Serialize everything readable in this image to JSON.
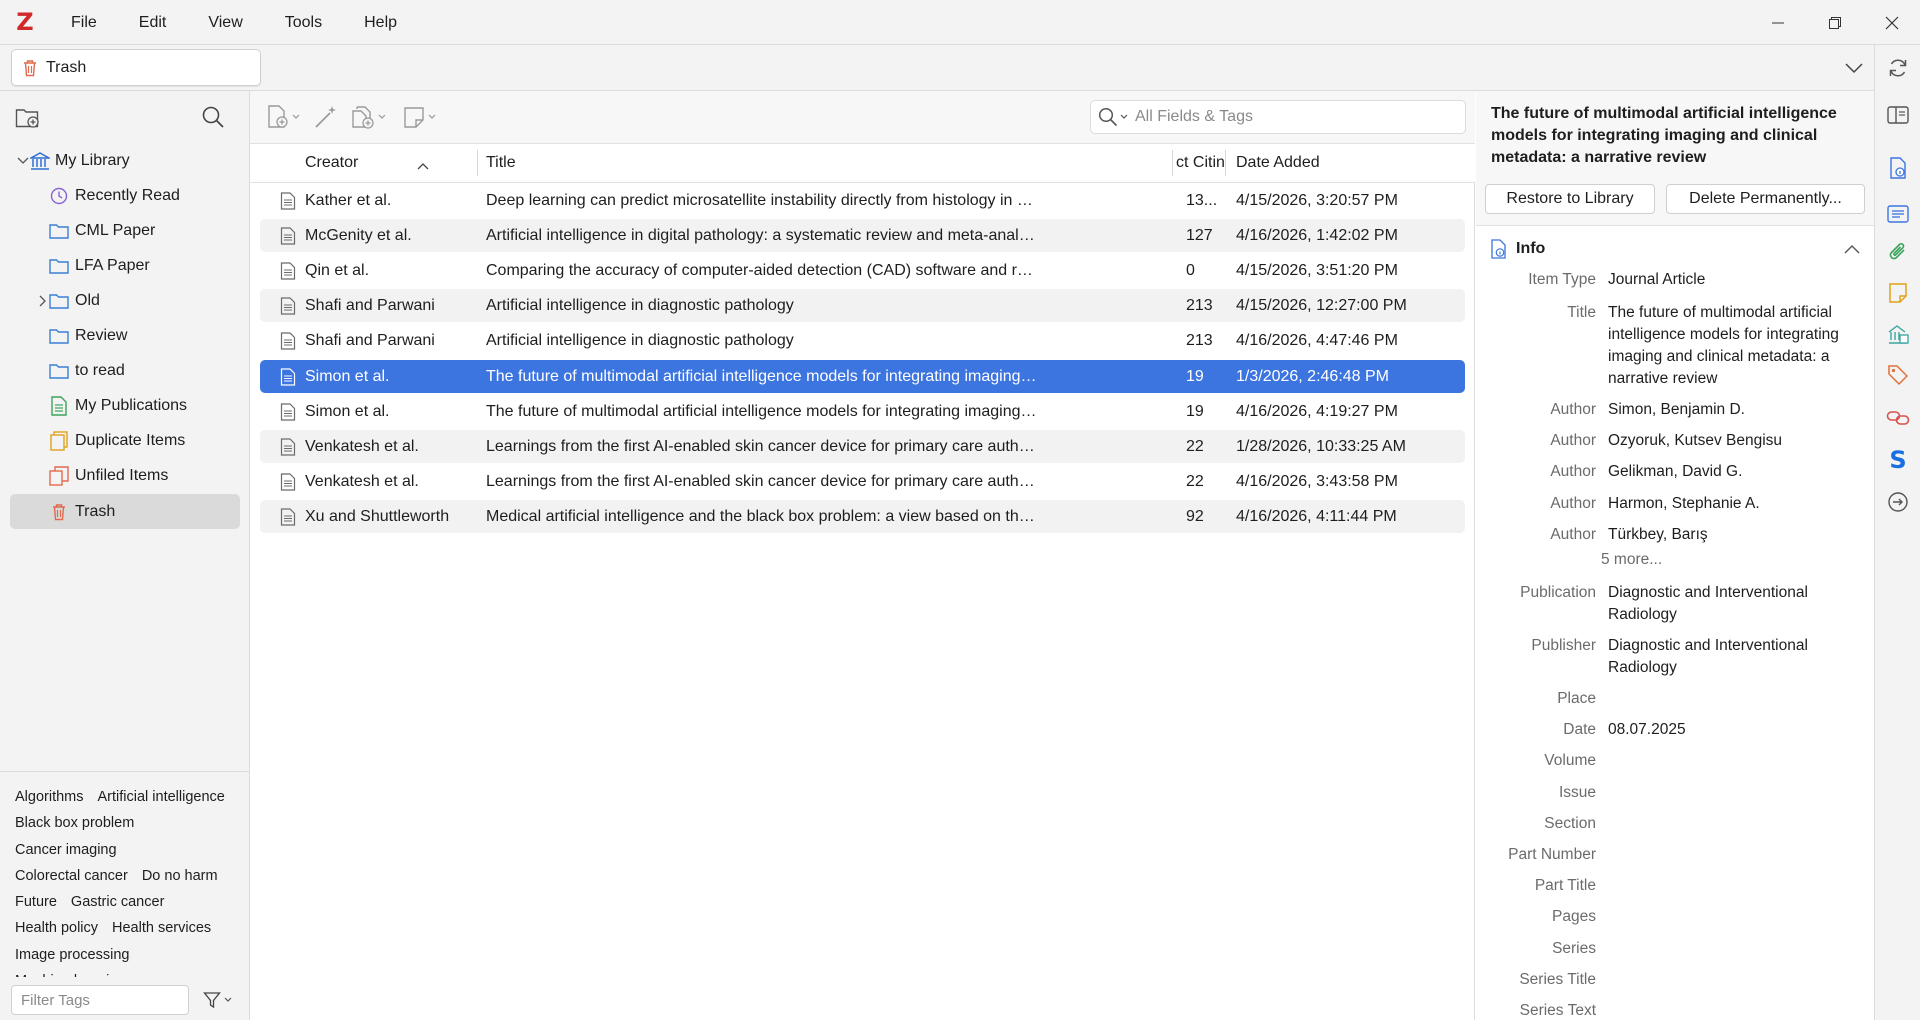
{
  "app": {
    "logo": "Z",
    "menu": [
      "File",
      "Edit",
      "View",
      "Tools",
      "Help"
    ]
  },
  "tab": {
    "label": "Trash"
  },
  "collections": [
    {
      "label": "My Library",
      "icon": "library-icon",
      "level": 0,
      "twisty": "open"
    },
    {
      "label": "Recently Read",
      "icon": "clock-icon",
      "level": 1
    },
    {
      "label": "CML Paper",
      "icon": "folder-icon",
      "level": 1
    },
    {
      "label": "LFA Paper",
      "icon": "folder-icon",
      "level": 1
    },
    {
      "label": "Old",
      "icon": "folder-icon",
      "level": 1,
      "twisty": "closed"
    },
    {
      "label": "Review",
      "icon": "folder-icon",
      "level": 1
    },
    {
      "label": "to read",
      "icon": "folder-icon",
      "level": 1
    },
    {
      "label": "My Publications",
      "icon": "publications-icon",
      "level": 1
    },
    {
      "label": "Duplicate Items",
      "icon": "duplicate-icon",
      "level": 1
    },
    {
      "label": "Unfiled Items",
      "icon": "unfiled-icon",
      "level": 1
    },
    {
      "label": "Trash",
      "icon": "trash-icon",
      "level": 1,
      "selected": true
    }
  ],
  "tags": [
    [
      "Algorithms",
      "Artificial intelligence"
    ],
    [
      "Black box problem"
    ],
    [
      "Cancer imaging"
    ],
    [
      "Colorectal cancer",
      "Do no harm"
    ],
    [
      "Future",
      "Gastric cancer"
    ],
    [
      "Health policy",
      "Health services"
    ],
    [
      "Image processing"
    ],
    [
      "Machine learning"
    ]
  ],
  "tag_filter": {
    "placeholder": "Filter Tags"
  },
  "search": {
    "placeholder": "All Fields & Tags"
  },
  "columns": {
    "creator": "Creator",
    "title": "Title",
    "citations": "ct Citin",
    "date_added": "Date Added"
  },
  "rows": [
    {
      "creator": "Kather et al.",
      "title": "Deep learning can predict microsatellite instability directly from histology in gastrointestinal cancer",
      "citations": "13...",
      "date_added": "4/15/2026, 3:20:57 PM"
    },
    {
      "creator": "McGenity et al.",
      "title": "Artificial intelligence in digital pathology: a systematic review and meta-analysis of diagnostic test accuracy",
      "citations": "127",
      "date_added": "4/16/2026, 1:42:02 PM"
    },
    {
      "creator": "Qin et al.",
      "title": "Comparing the accuracy of computer-aided detection (CAD) software and radiologists from low and middle income countries",
      "citations": "0",
      "date_added": "4/15/2026, 3:51:20 PM"
    },
    {
      "creator": "Shafi and Parwani",
      "title": "Artificial intelligence in diagnostic pathology",
      "citations": "213",
      "date_added": "4/15/2026, 12:27:00 PM"
    },
    {
      "creator": "Shafi and Parwani",
      "title": "Artificial intelligence in diagnostic pathology",
      "citations": "213",
      "date_added": "4/16/2026, 4:47:46 PM"
    },
    {
      "creator": "Simon et al.",
      "title": "The future of multimodal artificial intelligence models for integrating imaging and clinical metadata: a narrative review",
      "citations": "19",
      "date_added": "1/3/2026, 2:46:48 PM",
      "selected": true
    },
    {
      "creator": "Simon et al.",
      "title": "The future of multimodal artificial intelligence models for integrating imaging and clinical metadata: a narrative review",
      "citations": "19",
      "date_added": "4/16/2026, 4:19:27 PM"
    },
    {
      "creator": "Venkatesh et al.",
      "title": "Learnings from the first AI-enabled skin cancer device for primary care authorized by FDA",
      "citations": "22",
      "date_added": "1/28/2026, 10:33:25 AM"
    },
    {
      "creator": "Venkatesh et al.",
      "title": "Learnings from the first AI-enabled skin cancer device for primary care authorized by FDA",
      "citations": "22",
      "date_added": "4/16/2026, 3:43:58 PM"
    },
    {
      "creator": "Xu and Shuttleworth",
      "title": "Medical artificial intelligence and the black box problem: a view based on the ethical principle of do no harm",
      "citations": "92",
      "date_added": "4/16/2026, 4:11:44 PM"
    }
  ],
  "item": {
    "title": "The future of multimodal artificial intelligence models for integrating imaging and clinical metadata: a narrative review",
    "restore_label": "Restore to Library",
    "delete_label": "Delete Permanently...",
    "section_label": "Info",
    "more_label": "5 more...",
    "fields": [
      {
        "label": "Item Type",
        "value": "Journal Article"
      },
      {
        "label": "Title",
        "value": "The future of multimodal artificial intelligence models for integrating imaging and clinical metadata: a narrative review"
      },
      {
        "label": "Author",
        "value": "Simon, Benjamin D."
      },
      {
        "label": "Author",
        "value": "Ozyoruk, Kutsev Bengisu"
      },
      {
        "label": "Author",
        "value": "Gelikman, David G."
      },
      {
        "label": "Author",
        "value": "Harmon, Stephanie A."
      },
      {
        "label": "Author",
        "value": "Türkbey, Barış"
      },
      {
        "label": "Publication",
        "value": "Diagnostic and Interventional Radiology"
      },
      {
        "label": "Publisher",
        "value": "Diagnostic and Interventional Radiology"
      },
      {
        "label": "Place",
        "value": ""
      },
      {
        "label": "Date",
        "value": "08.07.2025"
      },
      {
        "label": "Volume",
        "value": ""
      },
      {
        "label": "Issue",
        "value": ""
      },
      {
        "label": "Section",
        "value": ""
      },
      {
        "label": "Part Number",
        "value": ""
      },
      {
        "label": "Part Title",
        "value": ""
      },
      {
        "label": "Pages",
        "value": ""
      },
      {
        "label": "Series",
        "value": ""
      },
      {
        "label": "Series Title",
        "value": ""
      },
      {
        "label": "Series Text",
        "value": ""
      }
    ]
  },
  "colors": {
    "accent": "#3c74e0",
    "logo": "#d12a2a",
    "folder": "#3b7fd4",
    "trash": "#e06a4e",
    "publications": "#3aa55b",
    "duplicate": "#e0a21b",
    "library": "#2f6fd3",
    "clock": "#8a63d2"
  }
}
